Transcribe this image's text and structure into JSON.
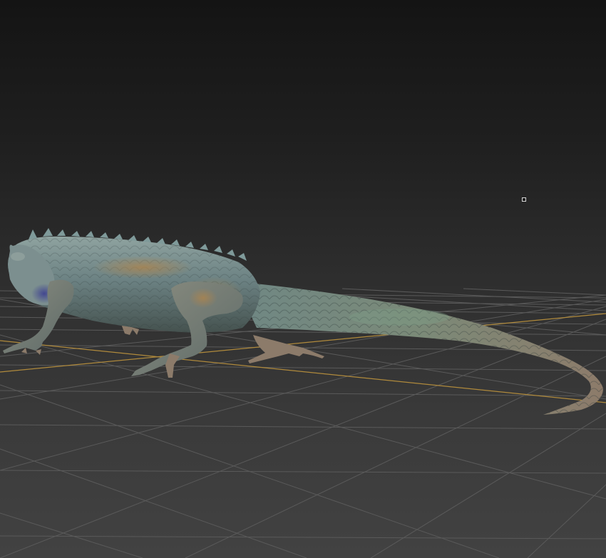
{
  "viewport": {
    "view": "perspective",
    "background_top": "#141414",
    "background_bottom": "#424242",
    "grid_color": "#5a5a5a",
    "grid_axis_color": "#b08a3c"
  },
  "scene": {
    "object": "lizard-mesh",
    "body_colors": {
      "main": "#6f8686",
      "shadow": "#3e4c4e",
      "highlight": "#9fb0a8",
      "belly": "#7d8a86",
      "warm": "#a07f58",
      "tail_tip": "#8a7a68",
      "accent_blue": "#4a4f8a"
    },
    "pivot_marker": "selection-pivot-icon"
  }
}
